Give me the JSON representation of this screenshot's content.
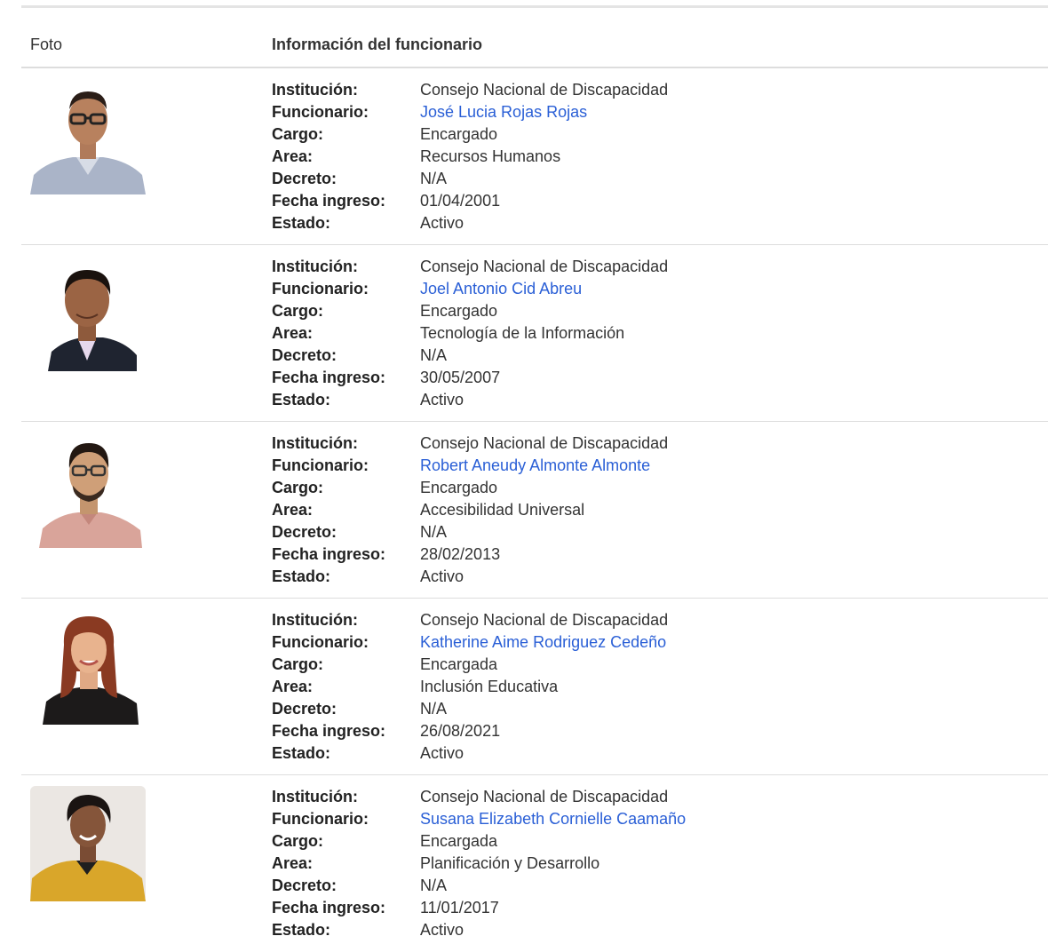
{
  "table": {
    "headers": {
      "photo": "Foto",
      "info": "Información del funcionario"
    },
    "labels": {
      "institucion": "Institución:",
      "funcionario": "Funcionario:",
      "cargo": "Cargo:",
      "area": "Area:",
      "decreto": "Decreto:",
      "fecha_ingreso": "Fecha ingreso:",
      "estado": "Estado:"
    },
    "rows": [
      {
        "institucion": "Consejo Nacional de Discapacidad",
        "funcionario": "José Lucia Rojas Rojas",
        "cargo": "Encargado",
        "area": "Recursos Humanos",
        "decreto": "N/A",
        "fecha_ingreso": "01/04/2001",
        "estado": "Activo"
      },
      {
        "institucion": "Consejo Nacional de Discapacidad",
        "funcionario": "Joel Antonio Cid Abreu",
        "cargo": "Encargado",
        "area": "Tecnología de la Información",
        "decreto": "N/A",
        "fecha_ingreso": "30/05/2007",
        "estado": "Activo"
      },
      {
        "institucion": "Consejo Nacional de Discapacidad",
        "funcionario": "Robert Aneudy Almonte Almonte",
        "cargo": "Encargado",
        "area": "Accesibilidad Universal",
        "decreto": "N/A",
        "fecha_ingreso": "28/02/2013",
        "estado": "Activo"
      },
      {
        "institucion": "Consejo Nacional de Discapacidad",
        "funcionario": "Katherine Aime Rodriguez Cedeño",
        "cargo": "Encargada",
        "area": "Inclusión Educativa",
        "decreto": "N/A",
        "fecha_ingreso": "26/08/2021",
        "estado": "Activo"
      },
      {
        "institucion": "Consejo Nacional de Discapacidad",
        "funcionario": "Susana Elizabeth Cornielle Caamaño",
        "cargo": "Encargada",
        "area": "Planificación y Desarrollo",
        "decreto": "N/A",
        "fecha_ingreso": "11/01/2017",
        "estado": "Activo"
      }
    ]
  },
  "colors": {
    "link": "#2a5fd6",
    "label": "#222222",
    "text": "#333333",
    "divider": "#dddddd"
  }
}
